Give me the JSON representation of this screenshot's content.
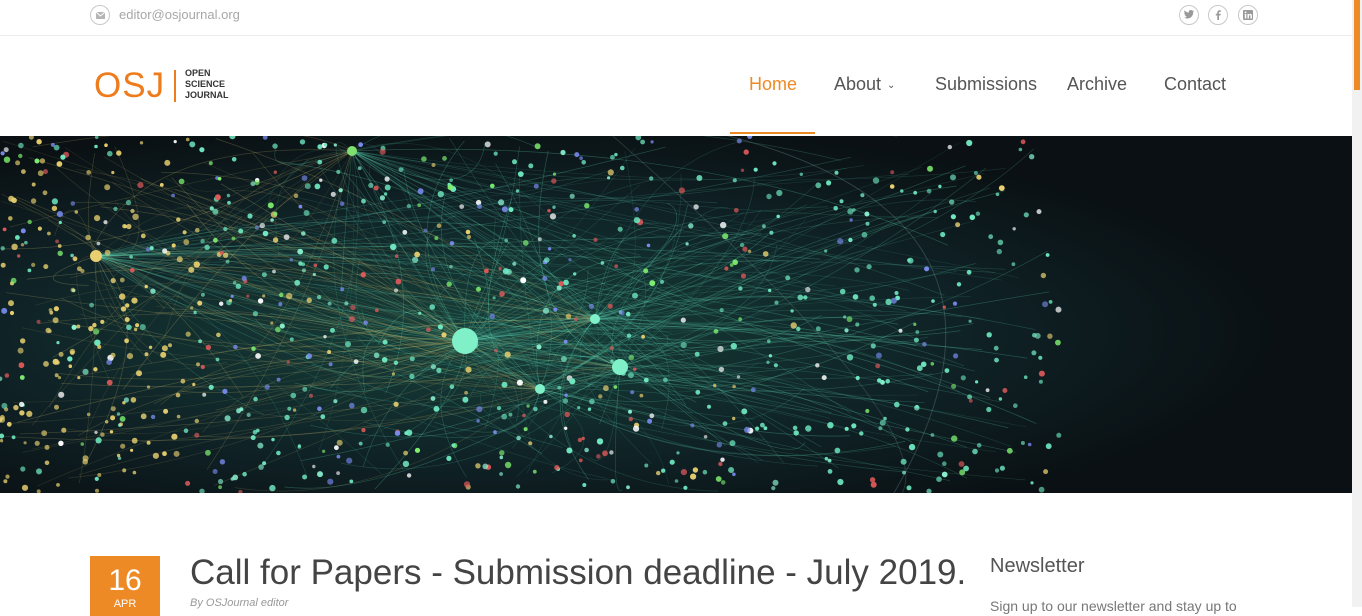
{
  "topbar": {
    "email": "editor@osjournal.org",
    "icons": [
      "mail-icon",
      "twitter-icon",
      "facebook-icon",
      "linkedin-icon"
    ]
  },
  "logo": {
    "mark": "OSJ",
    "line1": "OPEN",
    "line2": "SCIENCE",
    "line3": "JOURNAL"
  },
  "nav": {
    "home": "Home",
    "about": "About",
    "submissions": "Submissions",
    "archive": "Archive",
    "contact": "Contact",
    "active": "Home"
  },
  "colors": {
    "accent": "#ee8a25",
    "hero_bg": "#0c1418"
  },
  "post": {
    "day": "16",
    "month": "APR",
    "title": "Call for Papers - Submission deadline - July 2019.",
    "meta": "By OSJournal editor"
  },
  "sidebar": {
    "title": "Newsletter",
    "text": "Sign up to our newsletter and stay up to"
  }
}
